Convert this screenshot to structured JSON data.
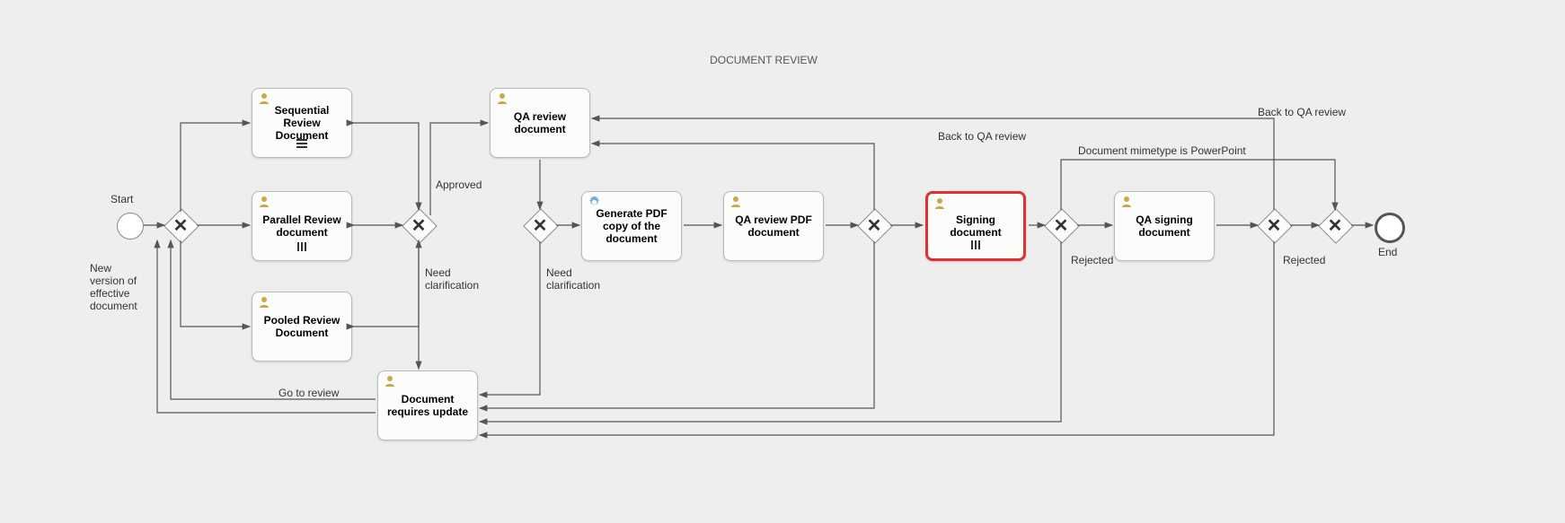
{
  "diagram": {
    "title": "DOCUMENT REVIEW",
    "start_label": "Start",
    "start_sublabel": "New\nversion of\neffective\ndocument",
    "end_label": "End",
    "tasks": {
      "sequential_review": "Sequential\nReview\nDocument",
      "parallel_review": "Parallel Review\ndocument",
      "pooled_review": "Pooled Review\nDocument",
      "qa_review": "QA review\ndocument",
      "generate_pdf": "Generate PDF\ncopy of the\ndocument",
      "qa_review_pdf": "QA review PDF\ndocument",
      "signing": "Signing\ndocument",
      "qa_signing": "QA signing\ndocument",
      "doc_requires_update": "Document\nrequires update"
    },
    "flow_labels": {
      "approved": "Approved",
      "need_clarification_1": "Need\nclarification",
      "need_clarification_2": "Need\nclarification",
      "back_to_qa_1": "Back to QA review",
      "back_to_qa_2": "Back to QA review",
      "mimetype_ppt": "Document mimetype is PowerPoint",
      "rejected_1": "Rejected",
      "rejected_2": "Rejected",
      "go_to_review": "Go to review"
    }
  }
}
